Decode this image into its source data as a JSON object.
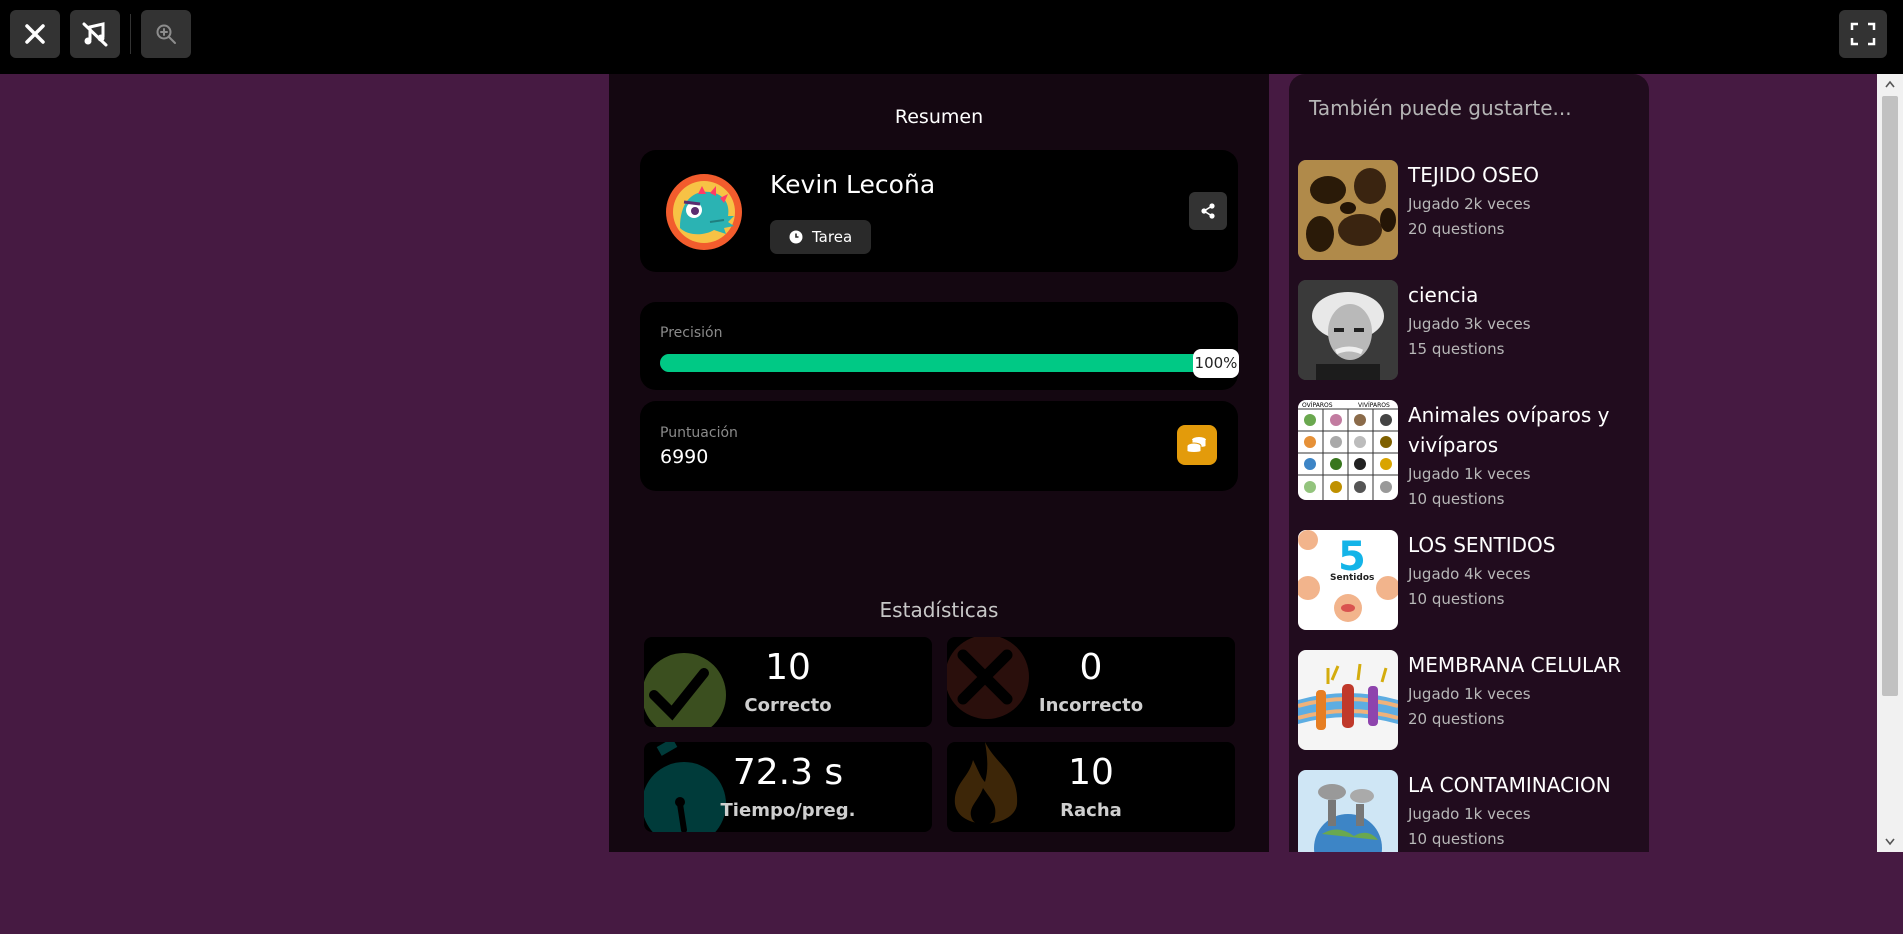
{
  "toolbar": {
    "close_icon": "close-icon",
    "music_off_icon": "music-off-icon",
    "zoom_icon": "zoom-in-icon",
    "fullscreen_icon": "fullscreen-icon"
  },
  "summary": {
    "title": "Resumen",
    "player": {
      "name": "Kevin Lecoña",
      "mode": "Tarea"
    },
    "accuracy": {
      "label": "Precisión",
      "value_text": "100%",
      "fraction": 1.0
    },
    "score": {
      "label": "Puntuación",
      "value": "6990"
    }
  },
  "stats": {
    "title": "Estadísticas",
    "correct": {
      "value": "10",
      "label": "Correcto"
    },
    "incorrect": {
      "value": "0",
      "label": "Incorrecto"
    },
    "time": {
      "value": "72.3 s",
      "label": "Tiempo/preg."
    },
    "streak": {
      "value": "10",
      "label": "Racha"
    }
  },
  "recommendations": {
    "title": "También puede gustarte...",
    "items": [
      {
        "title": "TEJIDO OSEO",
        "plays": "Jugado 2k veces",
        "questions": "20 questions"
      },
      {
        "title": "ciencia",
        "plays": "Jugado 3k veces",
        "questions": "15 questions"
      },
      {
        "title": "Animales ovíparos y vivíparos",
        "plays": "Jugado 1k veces",
        "questions": "10 questions"
      },
      {
        "title": "LOS SENTIDOS",
        "plays": "Jugado 4k veces",
        "questions": "10 questions"
      },
      {
        "title": "MEMBRANA CELULAR",
        "plays": "Jugado 1k veces",
        "questions": "20 questions"
      },
      {
        "title": "LA CONTAMINACION",
        "plays": "Jugado 1k veces",
        "questions": "10 questions"
      }
    ],
    "thumb_text": {
      "oviparos": "OVÍPAROS",
      "viviparos": "VIVÍPAROS",
      "five": "5",
      "sentidos": "Sentidos"
    }
  },
  "colors": {
    "background": "#461a42",
    "accent_green": "#00c985",
    "coin_orange": "#e39b0b"
  }
}
